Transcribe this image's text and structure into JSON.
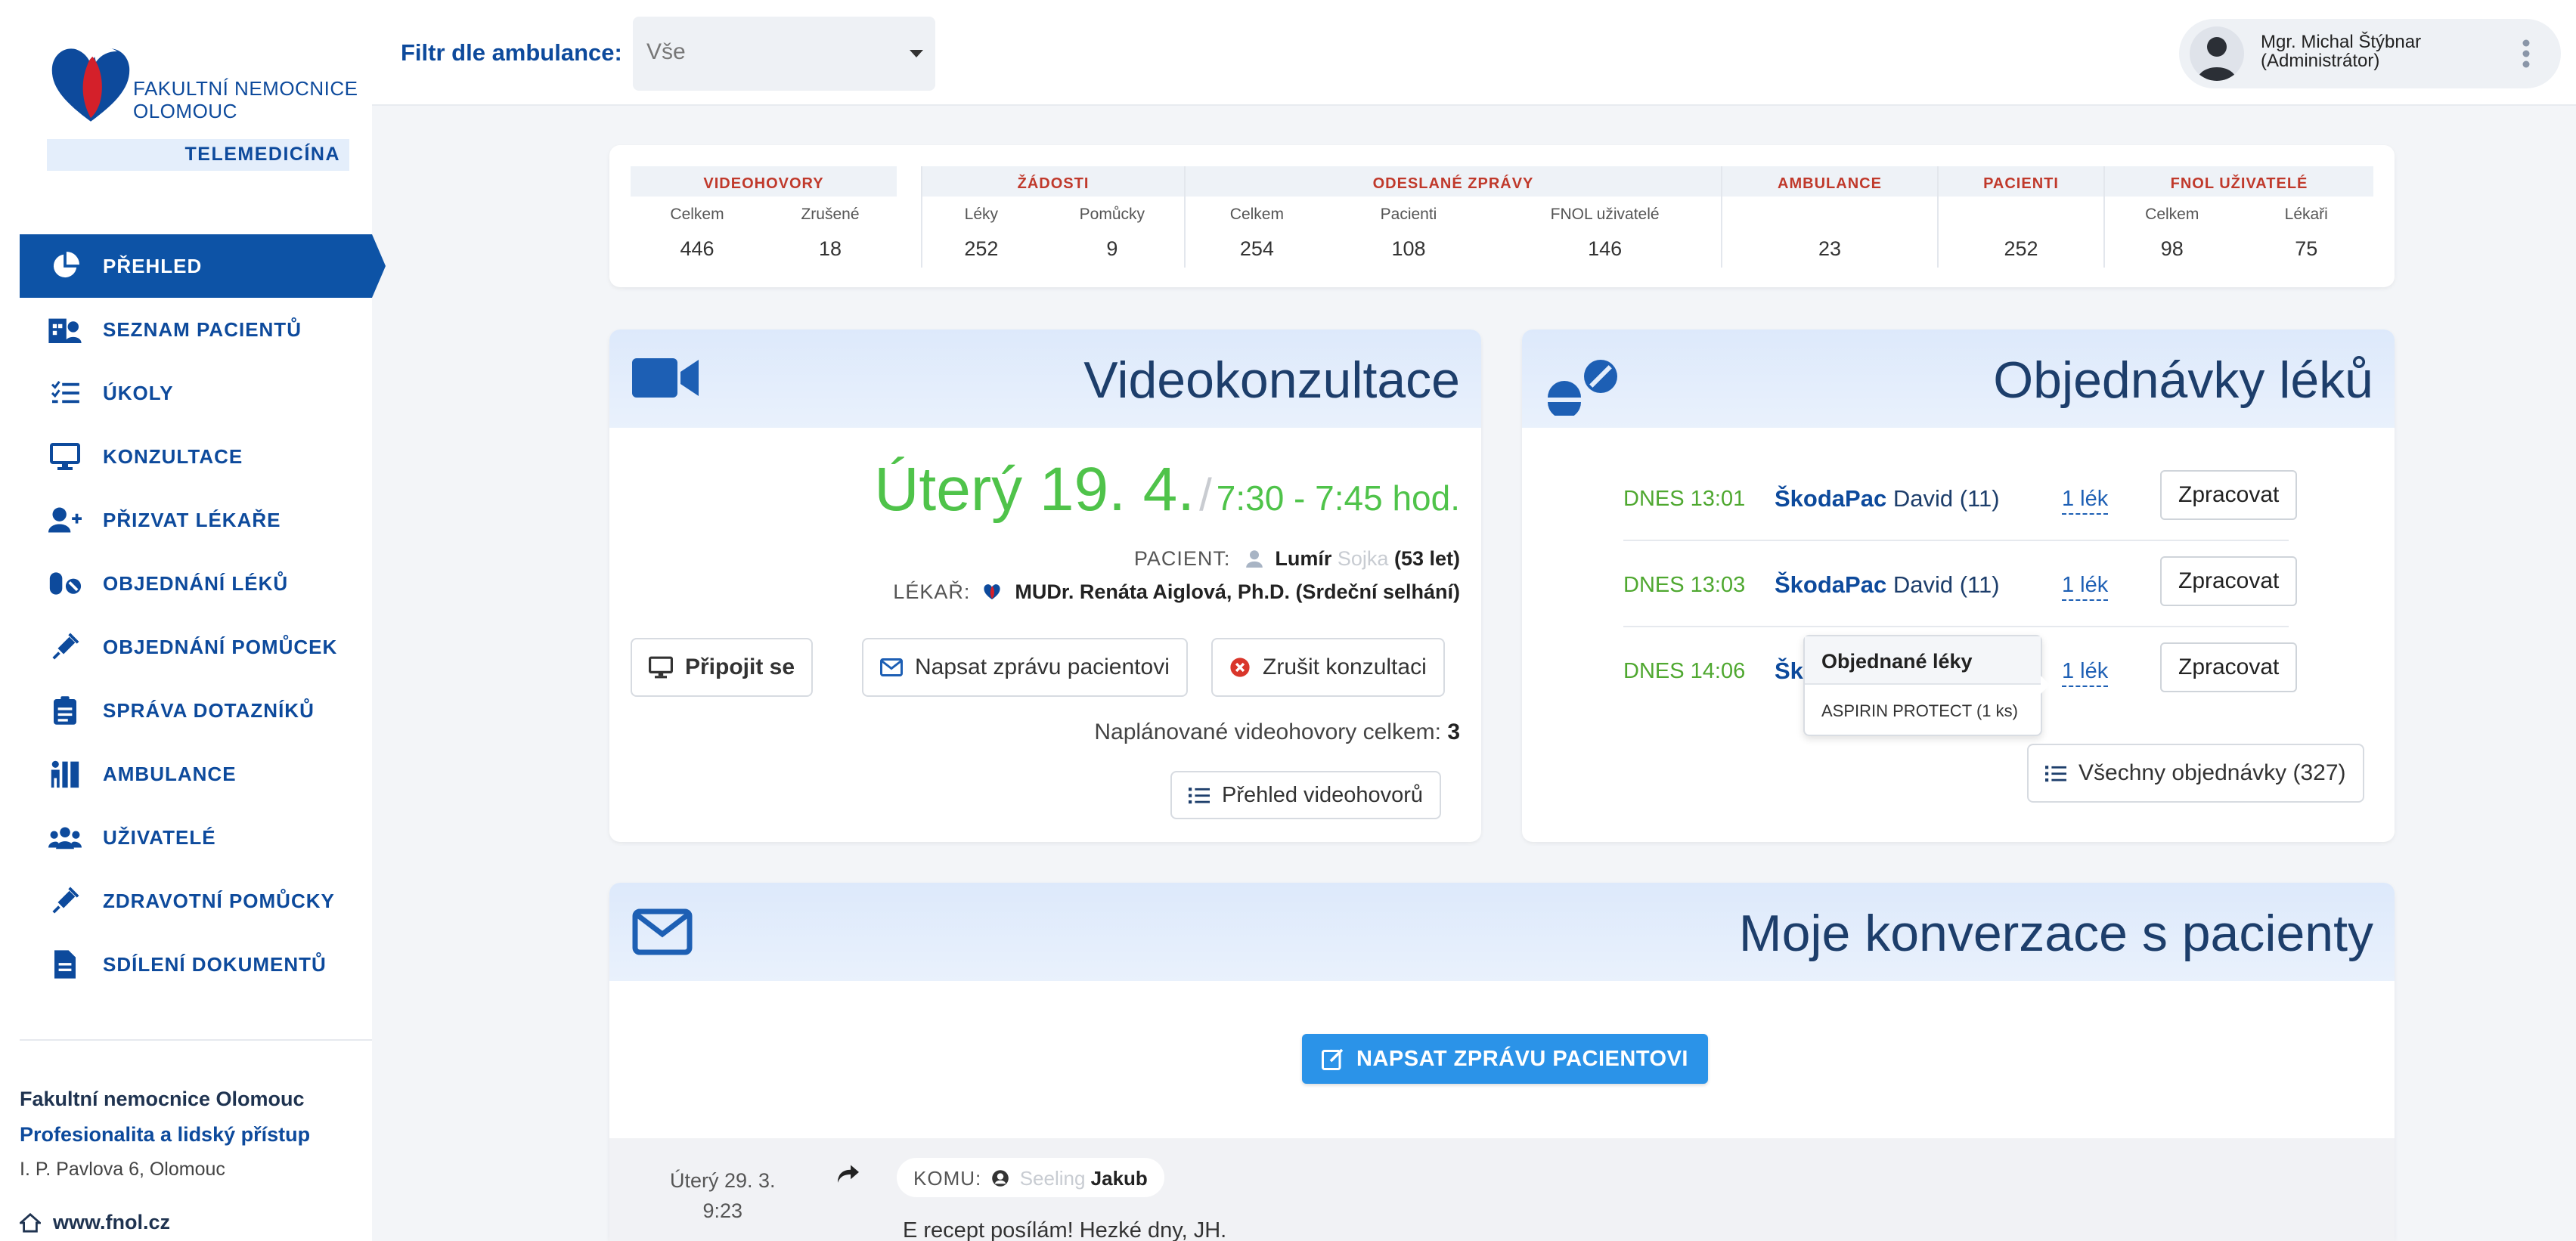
{
  "sidebar": {
    "logo_line1": "FAKULTNÍ NEMOCNICE",
    "logo_line2": "OLOMOUC",
    "logo_sub": "TELEMEDICÍNA",
    "items": [
      {
        "label": "PŘEHLED",
        "icon": "pie-chart-icon",
        "active": true
      },
      {
        "label": "SEZNAM PACIENTŮ",
        "icon": "hospital-user-icon"
      },
      {
        "label": "ÚKOLY",
        "icon": "task-list-icon"
      },
      {
        "label": "KONZULTACE",
        "icon": "monitor-icon"
      },
      {
        "label": "PŘIZVAT LÉKAŘE",
        "icon": "user-plus-icon"
      },
      {
        "label": "OBJEDNÁNÍ LÉKŮ",
        "icon": "pills-icon"
      },
      {
        "label": "OBJEDNÁNÍ POMŮCEK",
        "icon": "syringe-icon"
      },
      {
        "label": "SPRÁVA DOTAZNÍKŮ",
        "icon": "clipboard-icon"
      },
      {
        "label": "AMBULANCE",
        "icon": "clinic-icon"
      },
      {
        "label": "UŽIVATELÉ",
        "icon": "users-icon"
      },
      {
        "label": "ZDRAVOTNÍ POMŮCKY",
        "icon": "syringe-icon"
      },
      {
        "label": "SDÍLENÍ DOKUMENTŮ",
        "icon": "document-icon"
      }
    ],
    "footer": {
      "org": "Fakultní nemocnice Olomouc",
      "motto": "Profesionalita a lidský přístup",
      "address": "I. P. Pavlova 6, Olomouc",
      "web": "www.fnol.cz"
    }
  },
  "topbar": {
    "filter_label": "Filtr dle ambulance:",
    "filter_value": "Vše",
    "user_name": "Mgr. Michal Štýbnar",
    "user_role": "(Administrátor)"
  },
  "stats": {
    "groups": [
      {
        "title": "VIDEOHOVORY",
        "cols": [
          {
            "label": "Celkem",
            "value": "446"
          },
          {
            "label": "Zrušené",
            "value": "18"
          }
        ]
      },
      {
        "title": "ŽÁDOSTI",
        "cols": [
          {
            "label": "Léky",
            "value": "252"
          },
          {
            "label": "Pomůcky",
            "value": "9"
          }
        ]
      },
      {
        "title": "ODESLANÉ ZPRÁVY",
        "cols": [
          {
            "label": "Celkem",
            "value": "254"
          },
          {
            "label": "Pacienti",
            "value": "108"
          },
          {
            "label": "FNOL uživatelé",
            "value": "146"
          }
        ]
      },
      {
        "title": "AMBULANCE",
        "cols": [
          {
            "label": "",
            "value": "23"
          }
        ]
      },
      {
        "title": "PACIENTI",
        "cols": [
          {
            "label": "",
            "value": "252"
          }
        ]
      },
      {
        "title": "FNOL UŽIVATELÉ",
        "cols": [
          {
            "label": "Celkem",
            "value": "98"
          },
          {
            "label": "Lékaři",
            "value": "75"
          }
        ]
      }
    ]
  },
  "video": {
    "title": "Videokonzultace",
    "day": "Úterý 19. 4.",
    "time": "7:30 - 7:45 hod.",
    "patient_label": "PACIENT:",
    "patient_first": "Lumír",
    "patient_last_blurred": "Sojka",
    "patient_age": "(53 let)",
    "doctor_label": "LÉKAŘ:",
    "doctor": "MUDr. Renáta Aiglová, Ph.D. (Srdeční selhání)",
    "btn_connect": "Připojit se",
    "btn_message": "Napsat zprávu pacientovi",
    "btn_cancel": "Zrušit konzultaci",
    "planned_label": "Naplánované videohovory celkem:",
    "planned_count": "3",
    "btn_overview": "Přehled videohovorů"
  },
  "orders": {
    "title": "Objednávky léků",
    "rows": [
      {
        "time": "DNES 13:01",
        "brand": "ŠkodaPac",
        "name": "David (11)",
        "count": "1 lék",
        "action": "Zpracovat"
      },
      {
        "time": "DNES 13:03",
        "brand": "ŠkodaPac",
        "name": "David (11)",
        "count": "1 lék",
        "action": "Zpracovat"
      },
      {
        "time": "DNES 14:06",
        "brand": "Šk",
        "name": "",
        "count": "1 lék",
        "action": "Zpracovat"
      }
    ],
    "popover_title": "Objednané léky",
    "popover_body": "ASPIRIN PROTECT (1 ks)",
    "btn_all": "Všechny objednávky (327)"
  },
  "conversations": {
    "title": "Moje konverzace s pacienty",
    "btn_write": "NAPSAT ZPRÁVU PACIENTOVI",
    "msg_date": "Úterý 29. 3.",
    "msg_time": "9:23",
    "to_label": "KOMU:",
    "to_blurred": "Seeling",
    "to_name": "Jakub",
    "msg_text": "E recept posílám! Hezké dny, JH."
  },
  "colors": {
    "primary": "#0d53a6",
    "accent_green": "#4fc34a",
    "stat_red": "#c0392b",
    "button_blue": "#2b93e8"
  }
}
